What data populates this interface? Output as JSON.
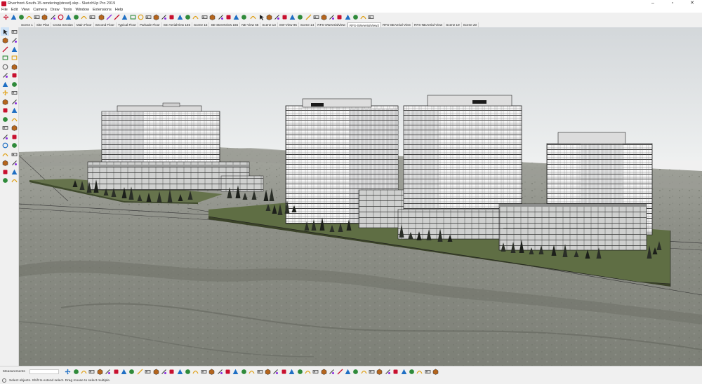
{
  "window": {
    "title": "Riverfront-South-15-rendering(street).skp - SketchUp Pro 2019",
    "minimize_glyph": "–",
    "maximize_glyph": "▫",
    "close_glyph": "✕"
  },
  "menubar": [
    "File",
    "Edit",
    "View",
    "Camera",
    "Draw",
    "Tools",
    "Window",
    "Extensions",
    "Help"
  ],
  "toolbar": {
    "icons": [
      "move-icon",
      "rotate-icon",
      "follow-me-icon",
      "scale-icon",
      "push-pull-icon",
      "offset-icon",
      "section-plane-icon",
      "orbit-icon",
      "pan-icon",
      "zoom-icon",
      "eraser-icon",
      "tape-measure-icon",
      "paint-bucket-icon",
      "line-icon",
      "pencil-icon",
      "freehand-icon",
      "rectangle-icon",
      "circle-icon",
      "polygon-icon",
      "arc-icon",
      "pie-icon",
      "text-icon",
      "dimension-icon",
      "protractor-icon",
      "axes-icon",
      "3d-text-icon",
      "walk-icon",
      "look-around-icon",
      "position-camera-icon",
      "warehouse-icon",
      "extension-warehouse-icon",
      "layout-icon",
      "select-icon",
      "component-icon",
      "styles-icon",
      "x-ray-icon",
      "back-edges-icon",
      "wireframe-icon",
      "hidden-line-icon",
      "shaded-icon",
      "textured-icon",
      "monochrome-icon",
      "geo-location-icon",
      "sun-icon",
      "fog-icon",
      "upload-icon",
      "download-icon"
    ]
  },
  "scenes": {
    "tabs": [
      "Scene 1",
      "Site Plan",
      "Cross Section",
      "Main Floor",
      "Second Floor",
      "Typical Floor",
      "Parkade Floor",
      "SE-AerialView 165",
      "Scene 15",
      "SE-StreetView 165",
      "NE-View 65",
      "Scene 13",
      "SW-View 95",
      "Scene 14",
      "RFS-SWAerialView",
      "RFS-SWAerialView2",
      "RFS-SEAerial-View",
      "RFS-NEAerial-View",
      "Scene 19",
      "Scene 20"
    ],
    "active_index": 15
  },
  "left_toolbar": {
    "icons": [
      "select-icon",
      "lasso-icon",
      "paint-bucket-icon",
      "eraser-icon",
      "line-icon",
      "freehand-icon",
      "rectangle-icon",
      "rotated-rectangle-icon",
      "circle-icon",
      "polygon-icon",
      "arc-icon",
      "two-point-arc-icon",
      "three-point-arc-icon",
      "pie-icon",
      "move-icon",
      "push-pull-icon",
      "rotate-icon",
      "follow-me-icon",
      "scale-icon",
      "offset-icon",
      "tape-measure-icon",
      "dimension-icon",
      "protractor-icon",
      "text-icon",
      "axes-icon",
      "3d-text-icon",
      "orbit-icon",
      "pan-icon",
      "zoom-icon",
      "zoom-window-icon",
      "zoom-extents-icon",
      "previous-view-icon",
      "position-camera-icon",
      "look-around-icon",
      "walk-icon",
      "section-plane-icon"
    ],
    "selected_index": 0
  },
  "measurements": {
    "label": "Measurements",
    "value": ""
  },
  "bottom_toolbar": {
    "icons": [
      "move-icon",
      "rotate-icon",
      "solid-tools-icon",
      "intersect-icon",
      "union-icon",
      "subtract-icon",
      "trim-icon",
      "split-icon",
      "layers-icon",
      "outliner-icon",
      "components-icon",
      "entity-info-icon",
      "materials-icon",
      "styles-icon",
      "sandbox-icon",
      "from-contours-icon",
      "from-scratch-icon",
      "smoove-icon",
      "stamp-icon",
      "drape-icon",
      "add-detail-icon",
      "flip-edge-icon",
      "camera-icon",
      "scenes-icon",
      "shadow-icon",
      "fog-icon",
      "soften-icon",
      "match-photo-icon",
      "section-cut-icon",
      "section-fill-icon",
      "display-sections-icon",
      "x-ray-icon",
      "back-edges-icon",
      "wireframe-icon",
      "hidden-line-icon",
      "shaded-icon",
      "textured-icon",
      "monochrome-icon",
      "iso-view-icon",
      "top-view-icon",
      "front-view-icon",
      "right-view-icon",
      "back-view-icon",
      "left-view-icon",
      "bottom-view-icon",
      "parallel-projection-icon",
      "perspective-icon"
    ]
  },
  "status": {
    "text": "Select objects. Shift to extend select. Drag mouse to select multiple."
  },
  "colors": {
    "sky_top": "#d8dcde",
    "sky_bottom": "#f0f1f1",
    "ground": "#8a8d84",
    "lawn": "#5e6e45",
    "building": "#f2f2f2",
    "building_lines": "#2a2a2a",
    "accent_red": "#c8102e",
    "accent_blue": "#1f6fc4"
  }
}
